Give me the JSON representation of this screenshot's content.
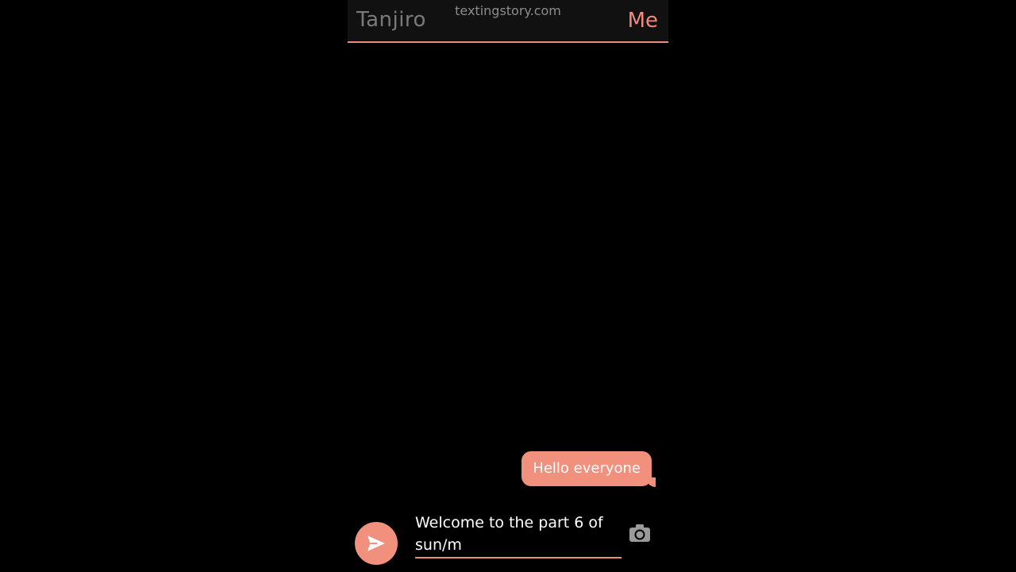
{
  "header": {
    "contact_name": "Tanjiro",
    "watermark": "textingstory.com",
    "me_label": "Me"
  },
  "messages": [
    {
      "sender": "Me",
      "text": "Hello everyone"
    }
  ],
  "composer": {
    "input_value": "Welcome to the part 6 of sun/m",
    "send_icon": "send-icon",
    "camera_icon": "camera-icon"
  },
  "colors": {
    "accent": "#f08a7a",
    "bubble": "#f0907d",
    "background": "#000000",
    "header_bg": "#111111",
    "muted_text": "#7a7a7a"
  }
}
